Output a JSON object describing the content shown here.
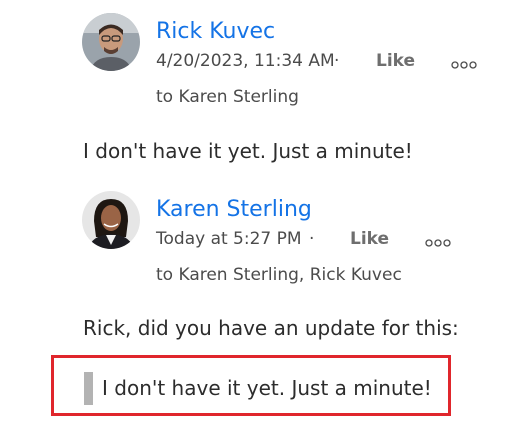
{
  "comments": [
    {
      "author": "Rick Kuvec",
      "timestamp": "4/20/2023, 11:34 AM",
      "separator": "·",
      "like_label": "Like",
      "more_label": "More options",
      "recipients": "to Karen Sterling",
      "body": "I don't have it yet. Just a minute!"
    },
    {
      "author": "Karen Sterling",
      "timestamp": "Today at 5:27 PM",
      "separator": "·",
      "like_label": "Like",
      "more_label": "More options",
      "recipients": "to Karen Sterling, Rick Kuvec",
      "body": "Rick, did you have an update for this:",
      "quote": "I don't have it yet. Just a minute!"
    }
  ],
  "colors": {
    "author_link": "#1473e6",
    "highlight_border": "#e0262c",
    "quote_bar": "#b3b3b3"
  },
  "icons": {
    "more": "ellipsis-icon"
  }
}
